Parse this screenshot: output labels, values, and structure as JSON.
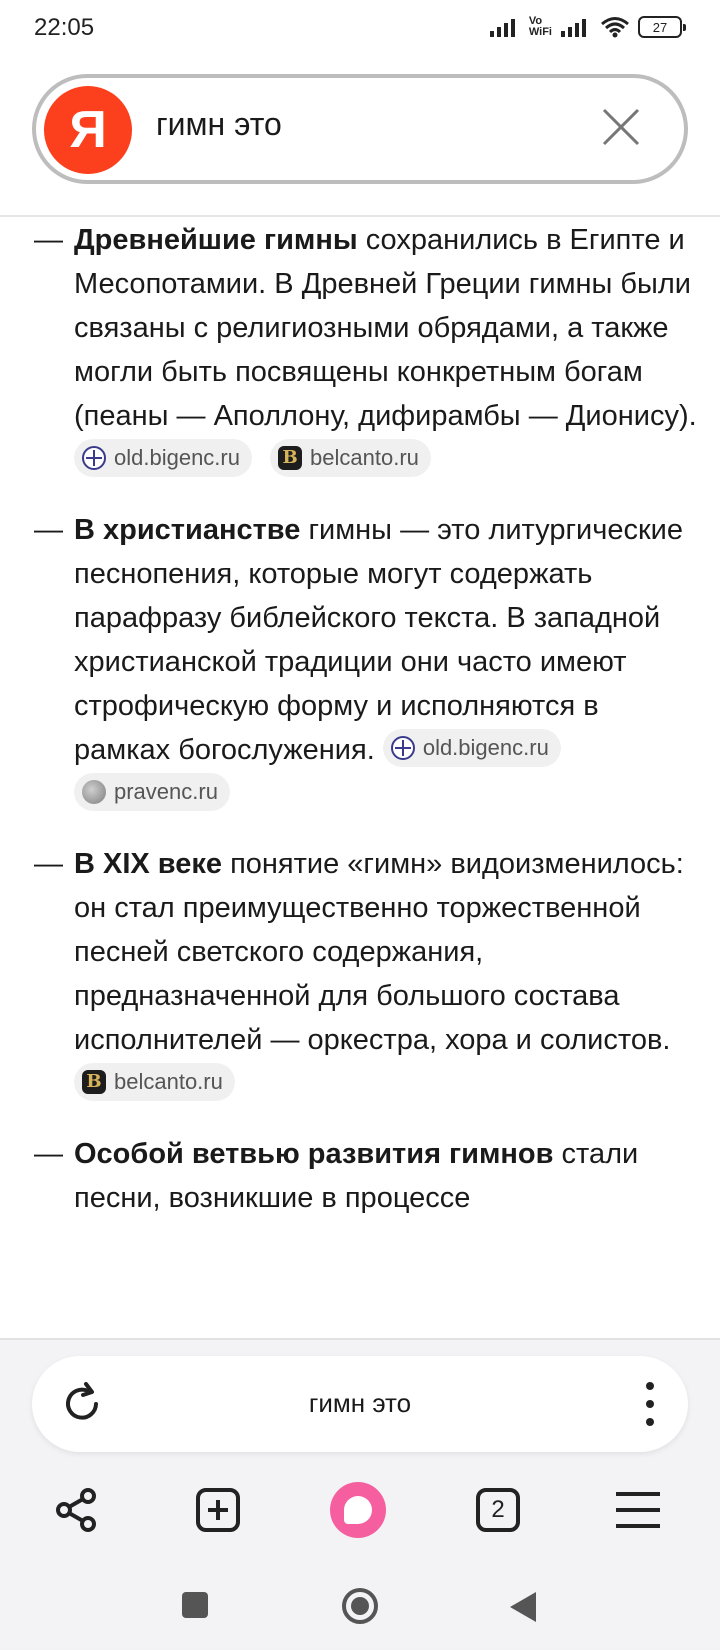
{
  "status_bar": {
    "time": "22:05",
    "volte_top": "Vo",
    "volte_bottom": "WiFi",
    "battery": "27"
  },
  "search": {
    "logo_letter": "Я",
    "query": "гимн это"
  },
  "content": {
    "items": [
      {
        "bold": "Древнейшие гимны",
        "text": " сохранились в Египте и Месопотамии. В Древней Греции гимны были связаны с религиозными обрядами, а также могли быть посвящены конкретным богам (пеаны —  Аполлону, дифирамбы — Дионису).",
        "sources": [
          "old.bigenc.ru",
          "belcanto.ru"
        ]
      },
      {
        "bold": "В христианстве",
        "text": " гимны — это литургические песнопения, которые могут содержать парафразу библейского текста. В западной христианской традиции они часто имеют строфическую форму и исполняются в рамках богослужения.",
        "sources": [
          "old.bigenc.ru",
          "pravenc.ru"
        ]
      },
      {
        "bold": "В XIX веке",
        "text": " понятие «гимн» видоизменилось: он стал преимущественно торжественной песней светского содержания, предназначенной для большого состава исполнителей — оркестра, хора и солистов.",
        "sources": [
          "belcanto.ru"
        ]
      },
      {
        "bold": "Особой ветвью развития гимнов",
        "text": " стали песни, возникшие в процессе",
        "sources": []
      }
    ],
    "source_icons": {
      "old.bigenc.ru": "globe-grid-icon",
      "belcanto.ru": "belcanto-b-icon",
      "pravenc.ru": "pravenc-globe-icon"
    }
  },
  "omnibox": {
    "query": "гимн это"
  },
  "toolbar": {
    "tabs_count": "2",
    "icons": [
      "share-icon",
      "new-tab-icon",
      "alice-icon",
      "tabs-icon",
      "menu-icon"
    ]
  },
  "colors": {
    "yandex_red": "#fc3f1d",
    "alice_pink": "#f55fa0"
  }
}
